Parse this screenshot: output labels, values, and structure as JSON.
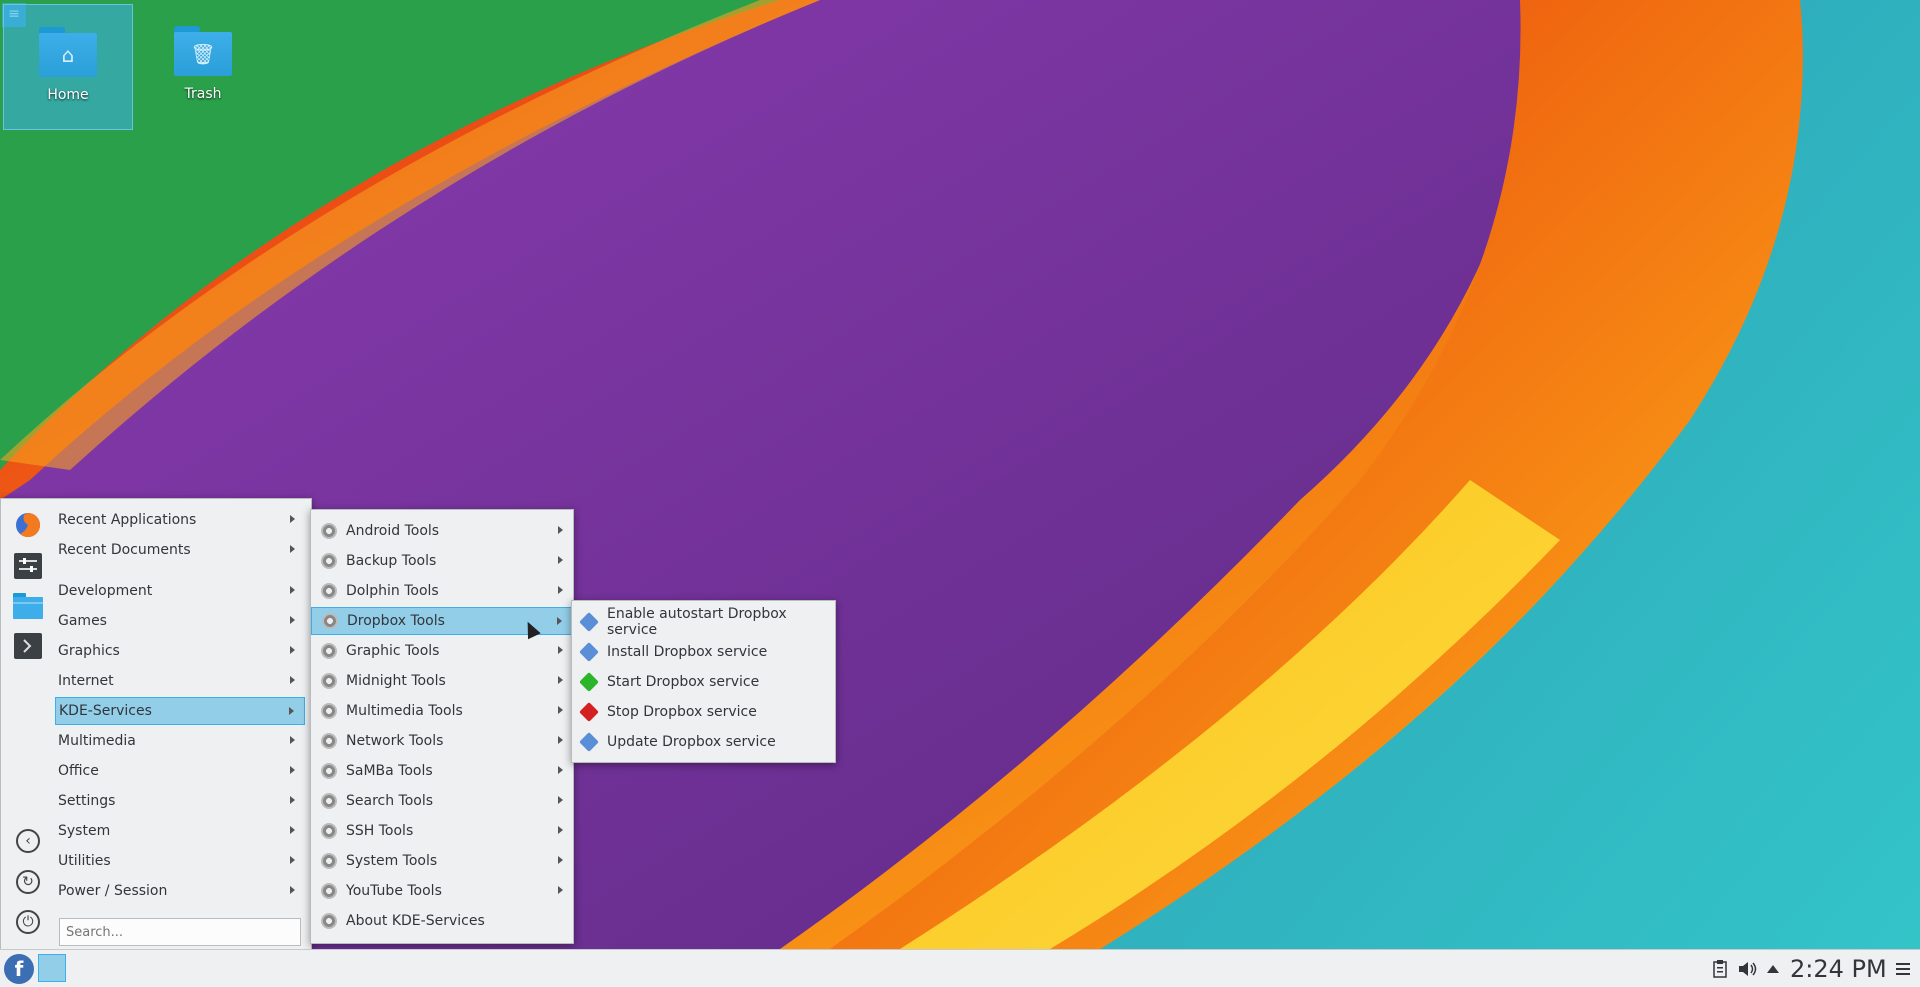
{
  "desktop": {
    "icons": [
      {
        "label": "Home",
        "icon": "home-folder-icon"
      },
      {
        "label": "Trash",
        "icon": "trash-folder-icon"
      }
    ],
    "toolbox_icon": "hamburger-icon"
  },
  "launcher": {
    "categories": [
      {
        "label": "Recent Applications"
      },
      {
        "label": "Recent Documents"
      },
      {
        "label": "Development"
      },
      {
        "label": "Games"
      },
      {
        "label": "Graphics"
      },
      {
        "label": "Internet"
      },
      {
        "label": "KDE-Services",
        "selected": true
      },
      {
        "label": "Multimedia"
      },
      {
        "label": "Office"
      },
      {
        "label": "Settings"
      },
      {
        "label": "System"
      },
      {
        "label": "Utilities"
      },
      {
        "label": "Power / Session"
      }
    ],
    "sidebar_icons": [
      "firefox-icon",
      "system-settings-icon",
      "file-manager-icon",
      "terminal-icon",
      "back-icon",
      "switch-user-icon",
      "shutdown-icon"
    ],
    "search_placeholder": "Search..."
  },
  "kde_services_menu": {
    "items": [
      {
        "label": "Android Tools"
      },
      {
        "label": "Backup Tools"
      },
      {
        "label": "Dolphin Tools"
      },
      {
        "label": "Dropbox Tools",
        "selected": true
      },
      {
        "label": "Graphic Tools"
      },
      {
        "label": "Midnight Tools"
      },
      {
        "label": "Multimedia Tools"
      },
      {
        "label": "Network Tools"
      },
      {
        "label": "SaMBa Tools"
      },
      {
        "label": "Search Tools"
      },
      {
        "label": "SSH Tools"
      },
      {
        "label": "System Tools"
      },
      {
        "label": "YouTube Tools"
      },
      {
        "label": "About KDE-Services"
      }
    ]
  },
  "dropbox_menu": {
    "items": [
      {
        "label": "Enable autostart Dropbox service",
        "color": "#5a8fd8"
      },
      {
        "label": "Install Dropbox service",
        "color": "#5a8fd8"
      },
      {
        "label": "Start Dropbox service",
        "color": "#2bb52b"
      },
      {
        "label": "Stop Dropbox service",
        "color": "#d42020"
      },
      {
        "label": "Update Dropbox service",
        "color": "#5a8fd8"
      }
    ]
  },
  "taskbar": {
    "clock": "2:24 PM",
    "tray_icons": [
      "clipboard-icon",
      "volume-icon",
      "expand-tray-icon",
      "panel-menu-icon"
    ]
  }
}
